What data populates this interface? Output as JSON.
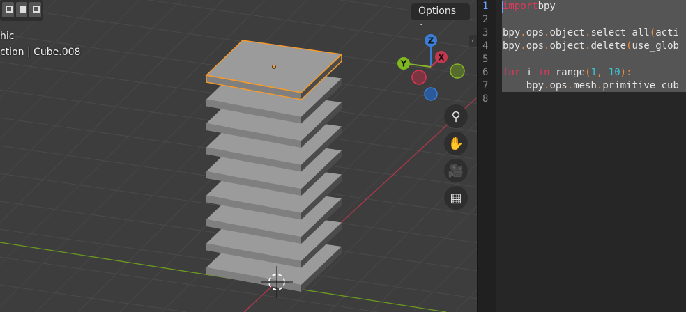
{
  "viewport": {
    "header_partial": "hic",
    "collection_partial": "ction",
    "active_object": "Cube.008",
    "options_label": "Options",
    "gizmo": {
      "z": "Z",
      "x": "X",
      "y": "Y"
    },
    "plate_count": 9,
    "colors": {
      "selected": "#f29a2e",
      "x_axis": "#b0384c",
      "y_axis": "#6c9a1f"
    }
  },
  "editor": {
    "line_numbers": [
      "1",
      "2",
      "3",
      "4",
      "5",
      "6",
      "7",
      "8"
    ],
    "lines": [
      [
        [
          "kw",
          "import"
        ],
        [
          "",
          "bpy"
        ]
      ],
      [],
      [
        [
          "",
          "bpy"
        ],
        [
          "pun",
          "."
        ],
        [
          "",
          "ops"
        ],
        [
          "pun",
          "."
        ],
        [
          "",
          "object"
        ],
        [
          "pun",
          "."
        ],
        [
          "",
          "select_all"
        ],
        [
          "pun",
          "("
        ],
        [
          "",
          "acti"
        ]
      ],
      [
        [
          "",
          "bpy"
        ],
        [
          "pun",
          "."
        ],
        [
          "",
          "ops"
        ],
        [
          "pun",
          "."
        ],
        [
          "",
          "object"
        ],
        [
          "pun",
          "."
        ],
        [
          "",
          "delete"
        ],
        [
          "pun",
          "("
        ],
        [
          "",
          "use_glob"
        ]
      ],
      [],
      [
        [
          "kw",
          "for"
        ],
        [
          "",
          " i "
        ],
        [
          "kw",
          "in"
        ],
        [
          "",
          " range"
        ],
        [
          "pun",
          "("
        ],
        [
          "num",
          "1"
        ],
        [
          "",
          "",
          " "
        ],
        [
          "pun",
          ","
        ],
        [
          "",
          " "
        ],
        [
          "num",
          "10"
        ],
        [
          "pun",
          "):"
        ]
      ],
      [
        [
          "",
          "    bpy"
        ],
        [
          "pun",
          "."
        ],
        [
          "",
          "ops"
        ],
        [
          "pun",
          "."
        ],
        [
          "",
          "mesh"
        ],
        [
          "pun",
          "."
        ],
        [
          "",
          "primitive_cub"
        ]
      ],
      []
    ]
  }
}
